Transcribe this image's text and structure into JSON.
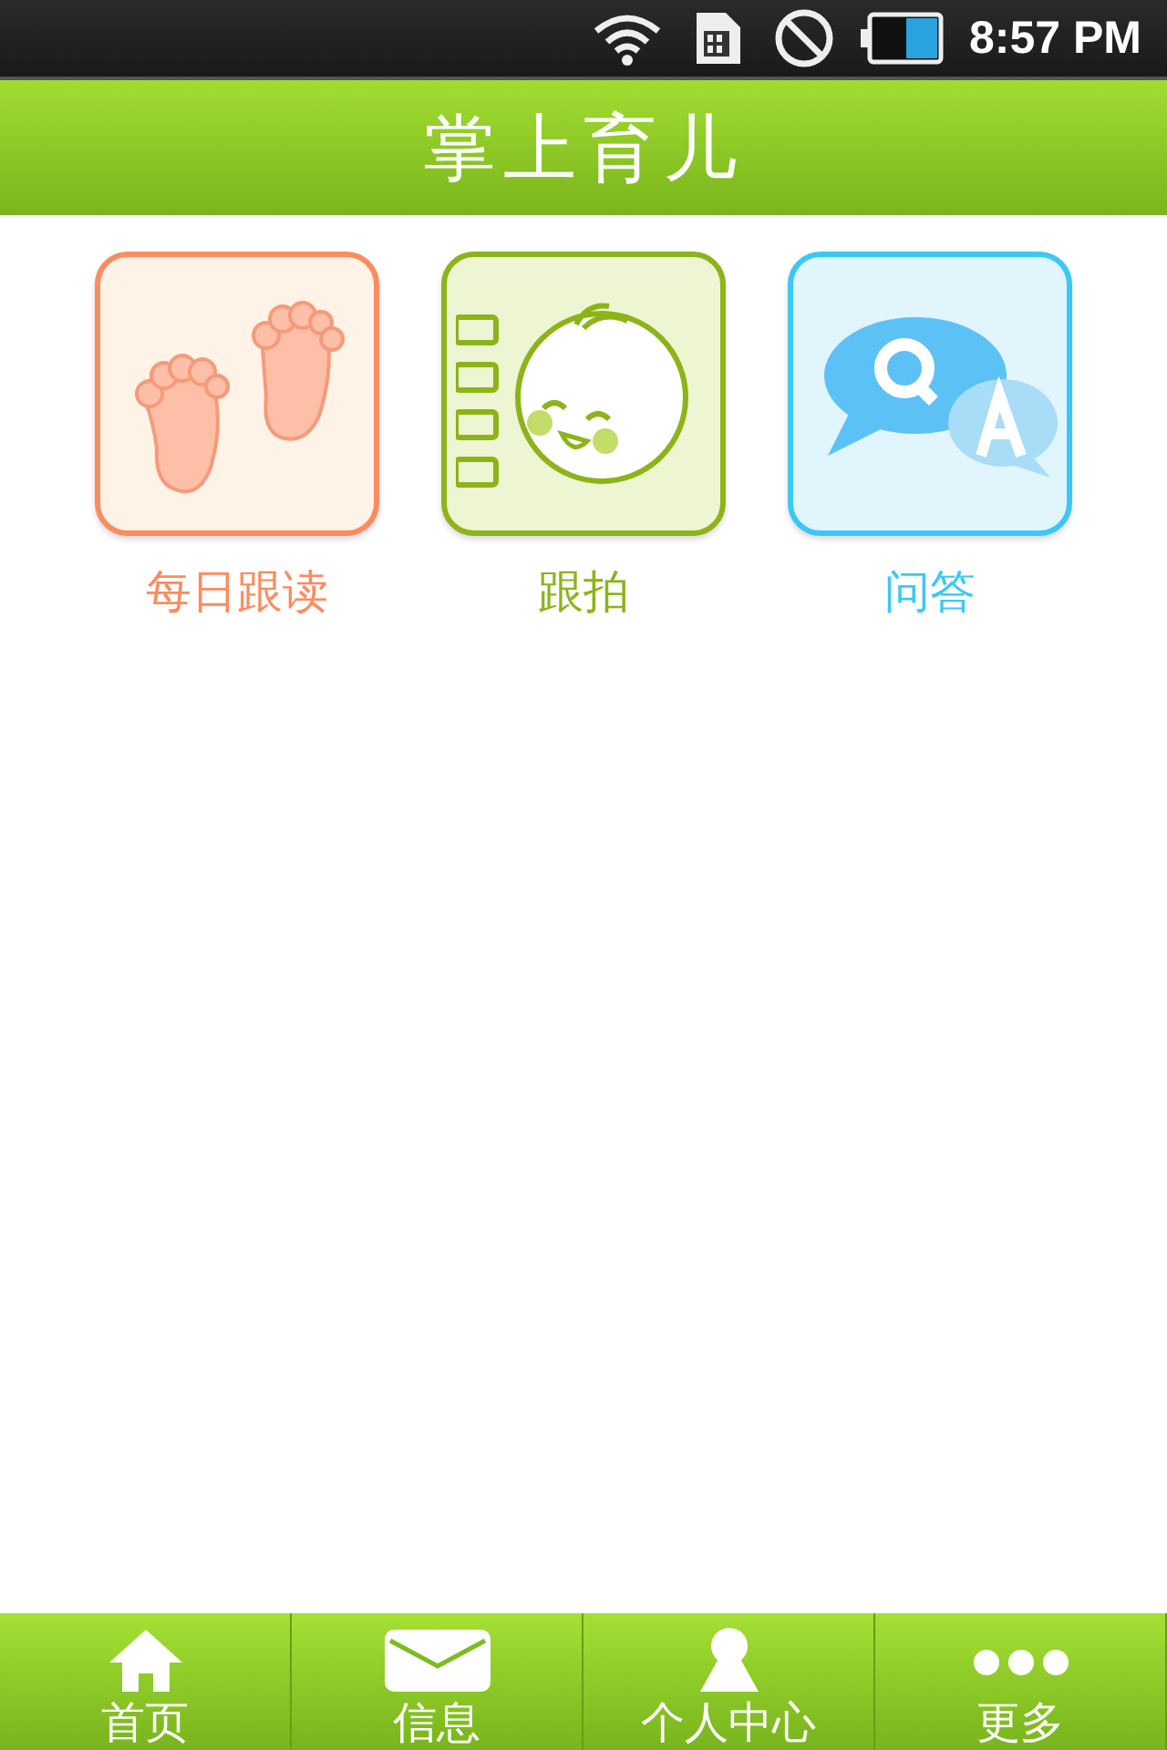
{
  "status_bar": {
    "time": "8:57 PM"
  },
  "header": {
    "title": "掌上育儿"
  },
  "tiles": [
    {
      "kind": "feet",
      "label": "每日跟读",
      "color": "#fa8c5f"
    },
    {
      "kind": "notebook",
      "label": "跟拍",
      "color": "#8cb419"
    },
    {
      "kind": "qa",
      "label": "问答",
      "color": "#3cc8f5"
    }
  ],
  "tab_bar": [
    {
      "kind": "home",
      "label": "首页"
    },
    {
      "kind": "mail",
      "label": "信息"
    },
    {
      "kind": "person",
      "label": "个人中心"
    },
    {
      "kind": "more",
      "label": "更多"
    }
  ]
}
